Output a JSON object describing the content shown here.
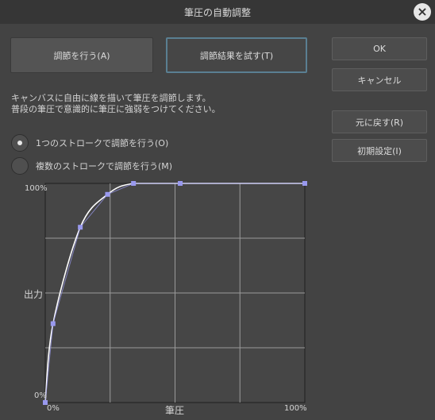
{
  "window": {
    "title": "筆圧の自動調整"
  },
  "toolbar": {
    "adjust_label": "調節を行う(A)",
    "test_label": "調節結果を試す(T)"
  },
  "side_buttons": {
    "ok": "OK",
    "cancel": "キャンセル",
    "undo": "元に戻す(R)",
    "reset": "初期設定(I)"
  },
  "description": {
    "line1": "キャンバスに自由に線を描いて筆圧を調節します。",
    "line2": "普段の筆圧で意識的に筆圧に強弱をつけてください。"
  },
  "mode": {
    "options": [
      {
        "label": "1つのストロークで調節を行う(O)",
        "selected": true
      },
      {
        "label": "複数のストロークで調節を行う(M)",
        "selected": false
      }
    ]
  },
  "graph": {
    "ylabel": "出力",
    "xlabel": "筆圧",
    "y_top": "100%",
    "y_bottom": "0%",
    "x_left": "0%",
    "x_right": "100%"
  },
  "chart_data": {
    "type": "line",
    "xlabel": "筆圧",
    "ylabel": "出力",
    "xlim": [
      0,
      100
    ],
    "ylim": [
      0,
      100
    ],
    "grid": true,
    "control_points": {
      "x": [
        0,
        3,
        13.5,
        24,
        34,
        52,
        100
      ],
      "y": [
        0,
        36,
        80,
        95,
        100,
        100,
        100
      ]
    },
    "colors": {
      "curve": "#ffffff",
      "points": "#9999ee",
      "grid": "#9a9a9a"
    }
  }
}
